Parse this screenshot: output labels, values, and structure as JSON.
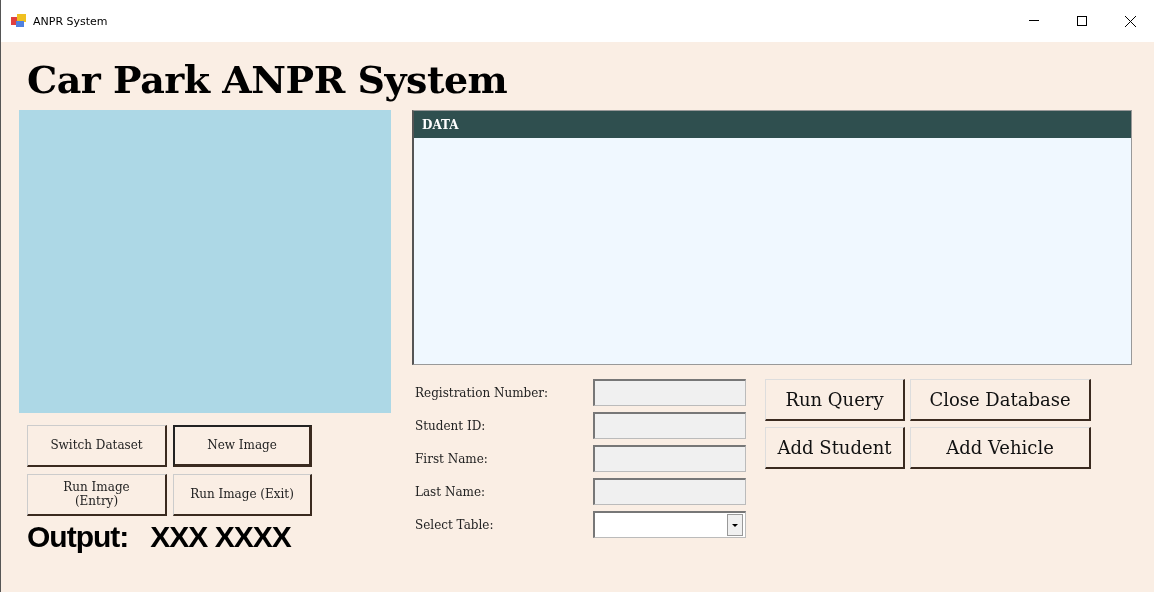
{
  "window": {
    "title": "ANPR System"
  },
  "heading": "Car Park ANPR System",
  "image_buttons": [
    {
      "label": "Switch Dataset",
      "focused": false
    },
    {
      "label": "New Image",
      "focused": true
    },
    {
      "label": "Run Image\n(Entry)",
      "focused": false
    },
    {
      "label": "Run Image (Exit)",
      "focused": false
    }
  ],
  "output": {
    "label": "Output:",
    "value": "XXX XXXX"
  },
  "data_grid": {
    "title": "DATA"
  },
  "form": [
    {
      "kind": "text",
      "label": "Registration Number:"
    },
    {
      "kind": "text",
      "label": "Student ID:"
    },
    {
      "kind": "text",
      "label": "First Name:"
    },
    {
      "kind": "text",
      "label": "Last Name:"
    },
    {
      "kind": "select",
      "label": "Select Table:"
    }
  ],
  "action_buttons": [
    {
      "label": "Run Query"
    },
    {
      "label": "Close Database"
    },
    {
      "label": "Add Student"
    },
    {
      "label": "Add Vehicle"
    }
  ]
}
